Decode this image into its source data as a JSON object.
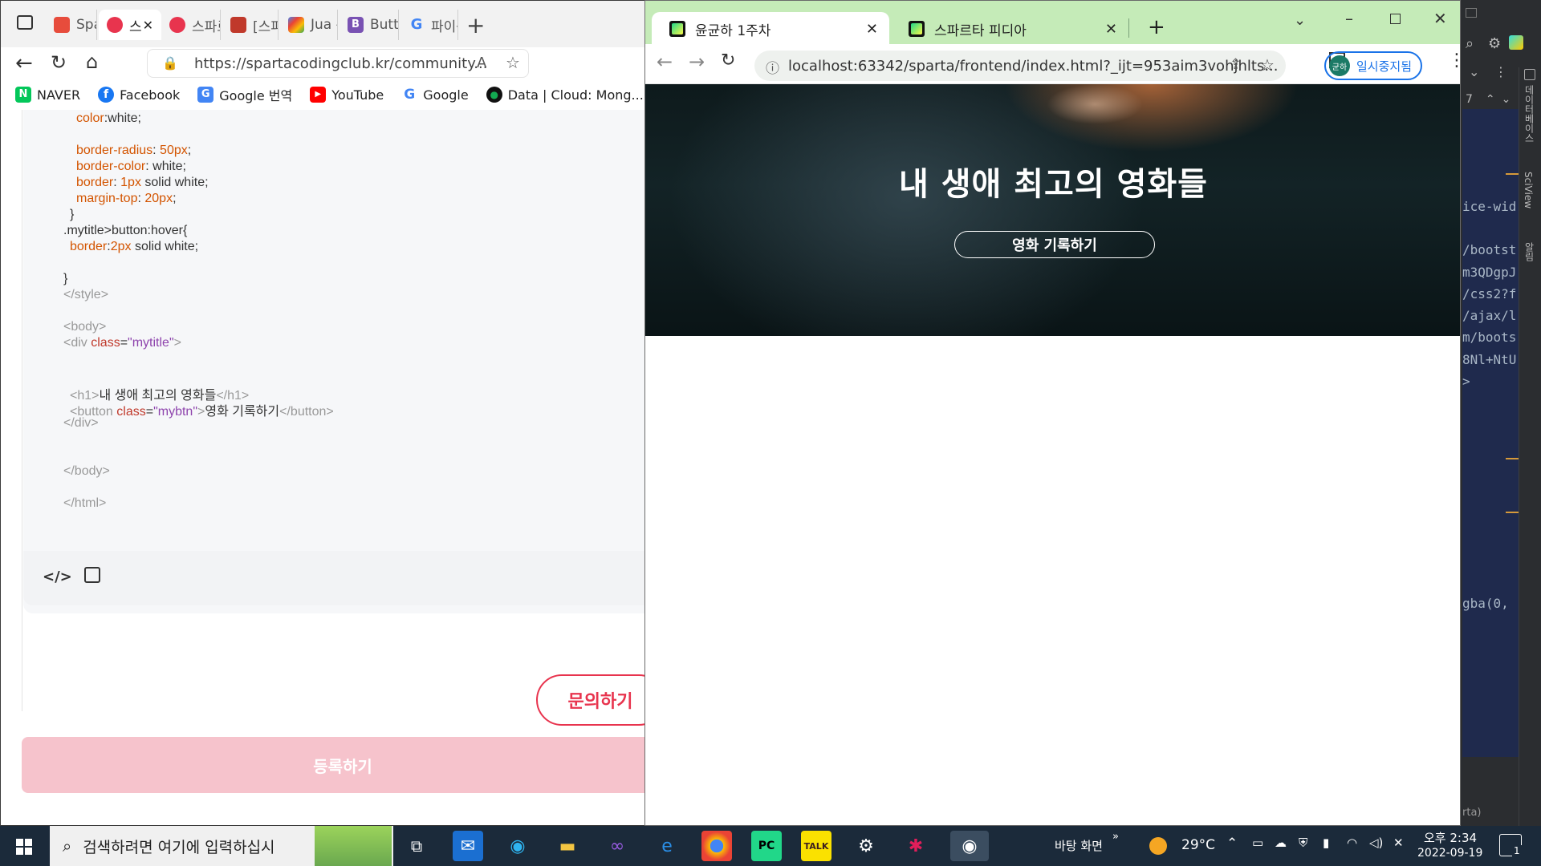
{
  "edge": {
    "tabs": [
      {
        "label": "Sparta",
        "color": "#e74c3c"
      },
      {
        "label": "스",
        "color": "#e8344e"
      },
      {
        "label": "스파르",
        "color": "#e8344e"
      },
      {
        "label": "[스파르",
        "color": "#c0392b"
      },
      {
        "label": "Jua - G",
        "color": "#4285f4"
      },
      {
        "label": "Button",
        "color": "#7952b3"
      },
      {
        "label": "파이썬",
        "color": "#4285f4"
      }
    ],
    "address": "https://spartacodingclub.kr/community...",
    "bookmarks": [
      {
        "label": "NAVER",
        "color": "#03c75a",
        "glyph": "N"
      },
      {
        "label": "Facebook",
        "color": "#1877f2",
        "glyph": "f"
      },
      {
        "label": "Google 번역",
        "color": "#4285f4",
        "glyph": "G"
      },
      {
        "label": "YouTube",
        "color": "#ff0000",
        "glyph": "▶"
      },
      {
        "label": "Google",
        "color": "#ffffff",
        "glyph": "G"
      },
      {
        "label": "Data | Cloud: Mong...",
        "color": "#13aa52",
        "glyph": "●"
      }
    ],
    "code_lines": {
      "l1_prop": "color",
      "l1_val": ":white;",
      "l2_prop": "border-radius",
      "l2_sep": ": ",
      "l2_num": "50px",
      "l2_end": ";",
      "l3_prop": "border-color",
      "l3_val": ": white;",
      "l4_prop": "border",
      "l4_sep": ": ",
      "l4_num": "1px",
      "l4_val": " solid white;",
      "l5_prop": "margin-top",
      "l5_sep": ": ",
      "l5_num": "20px",
      "l5_end": ";",
      "l6": "}",
      "l7": ".mytitle>button:hover{",
      "l8_prop": "border",
      "l8_sep": ":",
      "l8_num": "2px",
      "l8_val": " solid white;",
      "l9": "}",
      "l10_open": "</",
      "l10_tag": "style",
      "l10_close": ">",
      "l11_open": "<",
      "l11_tag": "body",
      "l11_close": ">",
      "l12_open": "<",
      "l12_tag": "div",
      "l12_attr": " class",
      "l12_eq": "=",
      "l12_str": "\"mytitle\"",
      "l12_close": ">",
      "l13_open": "<",
      "l13_tag": "h1",
      "l13_close": ">",
      "l13_text": "내 생애 최고의 영화들",
      "l13_end_open": "</",
      "l13_end_tag": "h1",
      "l13_end_close": ">",
      "l14_open": "<",
      "l14_tag": "button",
      "l14_attr": " class",
      "l14_eq": "=",
      "l14_str": "\"mybtn\"",
      "l14_close": ">",
      "l14_text": "영화 기록하기",
      "l14_end_open": "</",
      "l14_end_tag": "button",
      "l14_end_close": ">",
      "l15_open": "</",
      "l15_tag": "div",
      "l15_close": ">",
      "l16_open": "</",
      "l16_tag": "body",
      "l16_close": ">",
      "l17_open": "</",
      "l17_tag": "html",
      "l17_close": ">"
    },
    "ask_button": "문의하기",
    "submit_button": "등록하기"
  },
  "chrome": {
    "tabs": [
      {
        "label": "윤균하 1주차"
      },
      {
        "label": "스파르타 피디아"
      }
    ],
    "new_tab": "+",
    "address": "localhost:63342/sparta/frontend/index.html?_ijt=953aim3vohjhlts...",
    "profile_initials": "균하",
    "profile_label": "일시중지됨",
    "hero_title": "내 생애 최고의 영화들",
    "hero_button": "영화 기록하기"
  },
  "ide": {
    "lines": [
      "ice-wid",
      "/bootst",
      "m3QDgpJ",
      "/css2?f",
      "/ajax/l",
      "m/boots",
      "8Nl+NtU",
      ">",
      "gba(0,",
      "rta)"
    ],
    "top_label": "7",
    "rail_labels": [
      "데이터베이스",
      "SciView",
      "알림"
    ]
  },
  "taskbar": {
    "search_placeholder": "검색하려면 여기에 입력하십시",
    "desktop_label": "바탕 화면",
    "temperature": "29°C",
    "time": "오후 2:34",
    "date": "2022-09-19",
    "notification_count": "1"
  }
}
